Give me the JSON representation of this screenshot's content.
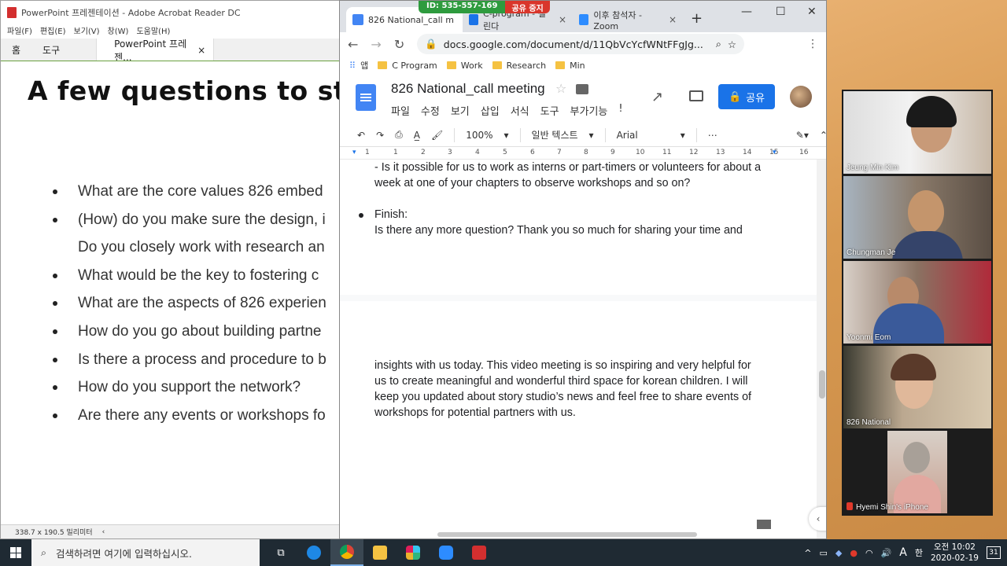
{
  "acrobat": {
    "window_title": "PowerPoint 프레젠테이션 - Adobe Acrobat Reader DC",
    "menu": [
      "파일(F)",
      "편집(E)",
      "보기(V)",
      "창(W)",
      "도움말(H)"
    ],
    "tabs": {
      "home": "홈",
      "tools": "도구",
      "doc": "PowerPoint 프레젠..."
    },
    "slide_title": "A few questions to st",
    "bullets": [
      "What are the core values 826 embed",
      "(How) do you make sure the design, i",
      "Do you closely work with research an",
      "What would be the key to fostering c",
      "What are the aspects of 826 experien",
      "How do you go about building partne",
      "Is there a process and procedure to b",
      "How do you support the network?",
      "Are there any events or workshops fo"
    ],
    "status_size": "338.7 x 190.5 밀리미터"
  },
  "chrome": {
    "tabs": [
      {
        "label": "826 National_call m",
        "color": "#4285f4"
      },
      {
        "label": "C-program - 갤린다",
        "color": "#1a73e8"
      },
      {
        "label": "이후 참석자 - Zoom",
        "color": "#2d8cff"
      }
    ],
    "share_banner": {
      "id": "ID: 535-557-169",
      "stop": "공유 중지"
    },
    "url": "docs.google.com/document/d/11QbVcYcfWNtFFgJg...",
    "bookmarks": [
      "앱",
      "C Program",
      "Work",
      "Research",
      "Min"
    ]
  },
  "docs": {
    "title": "826 National_call meeting",
    "menu": [
      "파일",
      "수정",
      "보기",
      "삽입",
      "서식",
      "도구",
      "부가기능",
      "!"
    ],
    "share_label": "공유",
    "zoom": "100%",
    "style": "일반 텍스트",
    "font": "Arial",
    "ruler": [
      "1",
      "1",
      "2",
      "3",
      "4",
      "5",
      "6",
      "7",
      "8",
      "9",
      "10",
      "11",
      "12",
      "13",
      "14",
      "15",
      "16",
      "17"
    ],
    "page1_lines": [
      "- Is it possible for us to work as interns or part-timers or volunteers for about a",
      "week at one of your chapters to observe workshops and so on?"
    ],
    "finish_label": "Finish:",
    "finish_line": "Is there any more question? Thank you so much for sharing your time and",
    "page2_lines": [
      "insights with us today. This video meeting is so inspiring and very helpful for",
      "us to create meaningful and wonderful third space for korean children. I will",
      "keep you updated about story studio’s news and feel free to share events of",
      "workshops for potential partners with us."
    ]
  },
  "zoom": {
    "participants": [
      {
        "name": "Jeung Min Kim",
        "muted": false
      },
      {
        "name": "Chungman Je",
        "muted": false
      },
      {
        "name": "Yoonmi Eom",
        "muted": false
      },
      {
        "name": "826 National",
        "muted": false
      },
      {
        "name": "Hyemi Shin's iPhone",
        "muted": true
      }
    ]
  },
  "taskbar": {
    "search_placeholder": "검색하려면 여기에 입력하십시오.",
    "ime": "A",
    "lang": "한",
    "time": "오전 10:02",
    "date": "2020-02-19",
    "notifications": "31"
  }
}
